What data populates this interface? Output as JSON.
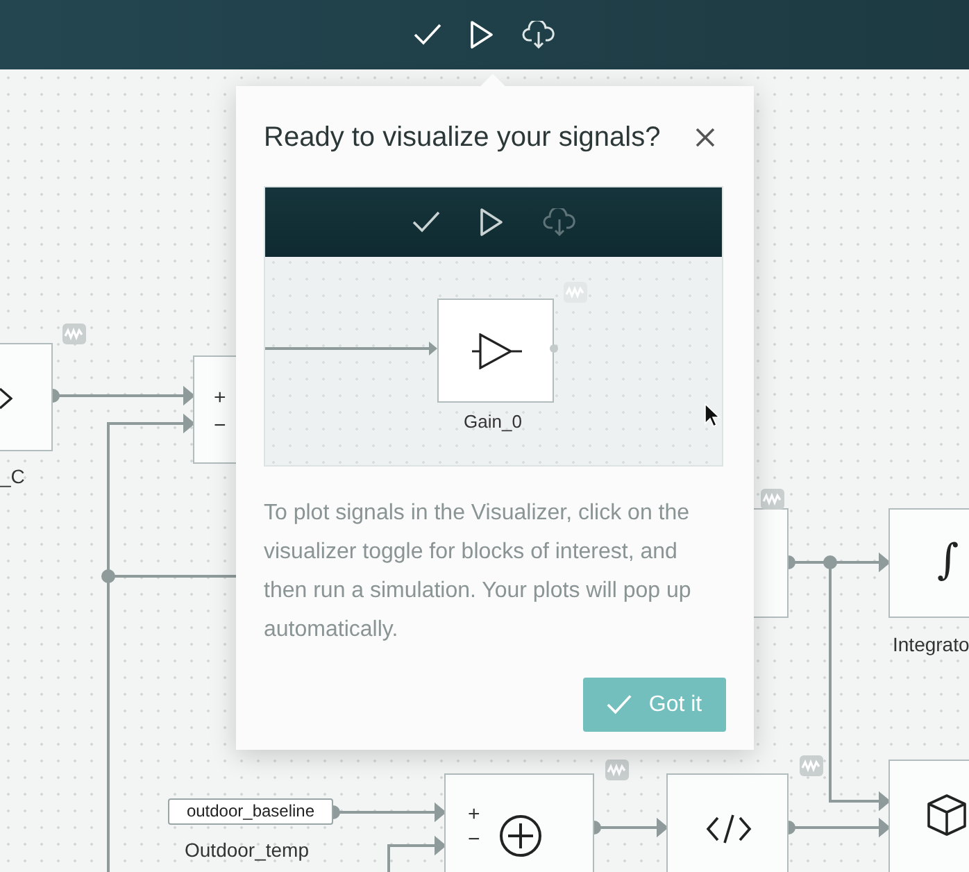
{
  "popover": {
    "title": "Ready to visualize your signals?",
    "preview": {
      "block_label": "Gain_0"
    },
    "body": "To plot signals in the Visualizer, click on the visualizer toggle for blocks of interest, and then run a simulation. Your plots will pop up automatically.",
    "button": "Got it"
  },
  "diagram": {
    "blocks": [
      {
        "kind": "chevron",
        "label": "_C"
      },
      {
        "kind": "sum",
        "ports": [
          "+",
          "−"
        ]
      },
      {
        "kind": "plain"
      },
      {
        "kind": "integrator",
        "symbol": "∫",
        "label": "Integrato"
      },
      {
        "kind": "cube"
      },
      {
        "kind": "sum_circle",
        "ports": [
          "+",
          "−"
        ]
      },
      {
        "kind": "code"
      }
    ],
    "constant": {
      "value": "outdoor_baseline",
      "label": "Outdoor_temp"
    }
  }
}
